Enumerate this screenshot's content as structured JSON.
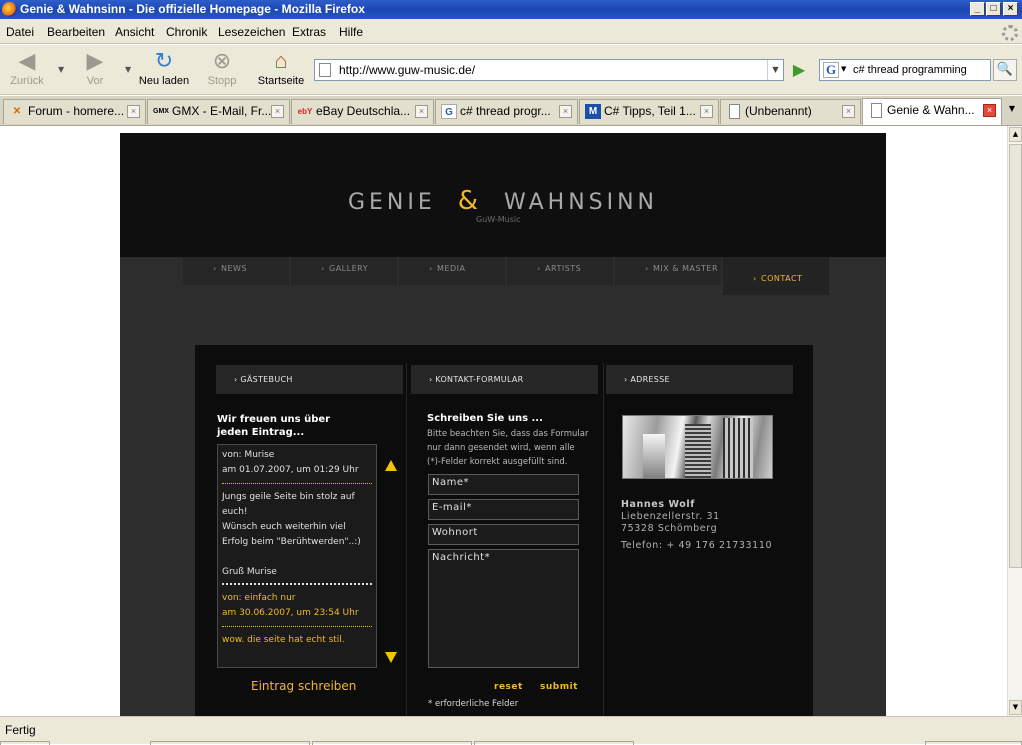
{
  "window": {
    "title": "Genie & Wahnsinn - Die offizielle Homepage - Mozilla Firefox",
    "controls": [
      "_",
      "□",
      "×"
    ]
  },
  "menu": [
    "Datei",
    "Bearbeiten",
    "Ansicht",
    "Chronik",
    "Lesezeichen",
    "Extras",
    "Hilfe"
  ],
  "toolbar": {
    "back": "Zurück",
    "forward": "Vor",
    "reload": "Neu laden",
    "stop": "Stopp",
    "home": "Startseite"
  },
  "address": {
    "url": "http://www.guw-music.de/"
  },
  "search": {
    "value": "c# thread programming"
  },
  "tabs": [
    {
      "label": "Forum - homere...",
      "icon": "forum-favicon"
    },
    {
      "label": "GMX - E-Mail, Fr...",
      "icon": "gmx-favicon"
    },
    {
      "label": "eBay Deutschla...",
      "icon": "ebay-favicon"
    },
    {
      "label": "c# thread progr...",
      "icon": "google-favicon"
    },
    {
      "label": "C# Tipps, Teil 1...",
      "icon": "m-favicon"
    },
    {
      "label": "(Unbenannt)",
      "icon": "blank-page-icon"
    },
    {
      "label": "Genie & Wahn...",
      "icon": "blank-page-icon"
    }
  ],
  "status": {
    "text": "Fertig"
  },
  "site": {
    "logo_left": "GENIE",
    "logo_amp": "&",
    "logo_right": "WAHNSINN",
    "logo_sub": "GuW-Music",
    "nav": [
      "NEWS",
      "GALLERY",
      "MEDIA",
      "ARTISTS",
      "MIX & MASTER",
      "CONTACT"
    ],
    "guestbook": {
      "heading": "GÄSTEBUCH",
      "intro_1": "Wir freuen uns über",
      "intro_2": "jeden Eintrag...",
      "entry1_from": "von: Murise",
      "entry1_date": "am 01.07.2007, um 01:29 Uhr",
      "entry1_line1": "Jungs geile Seite bin stolz auf",
      "entry1_line2": "euch!",
      "entry1_line3": "Wünsch euch weiterhin viel",
      "entry1_line4": "Erfolg beim \"Berühtwerden\"..:)",
      "entry1_sign": "Gruß Murise",
      "entry2_from": "von: einfach nur",
      "entry2_date": "am 30.06.2007, um 23:54 Uhr",
      "entry2_text": "wow. die seite hat echt stil.",
      "write": "Eintrag schreiben"
    },
    "contact": {
      "heading": "KONTAKT-FORMULAR",
      "title": "Schreiben Sie uns ...",
      "info_1": "Bitte beachten Sie, dass das Formular",
      "info_2": "nur dann gesendet wird, wenn alle",
      "info_3": "(*)-Felder korrekt ausgefüllt sind.",
      "name": "Name*",
      "email": "E-mail*",
      "city": "Wohnort",
      "message": "Nachricht*",
      "reset": "reset",
      "submit": "submit",
      "required": "* erforderliche Felder"
    },
    "address": {
      "heading": "ADRESSE",
      "name": "Hannes Wolf",
      "street": "Liebenzellerstr. 31",
      "city": "75328 Schömberg",
      "phone": "Telefon:  + 49  176 21733110"
    }
  },
  "colors": {
    "accent": "#f2b927",
    "background": "#2d2d2d",
    "header": "#0f0f0f"
  }
}
